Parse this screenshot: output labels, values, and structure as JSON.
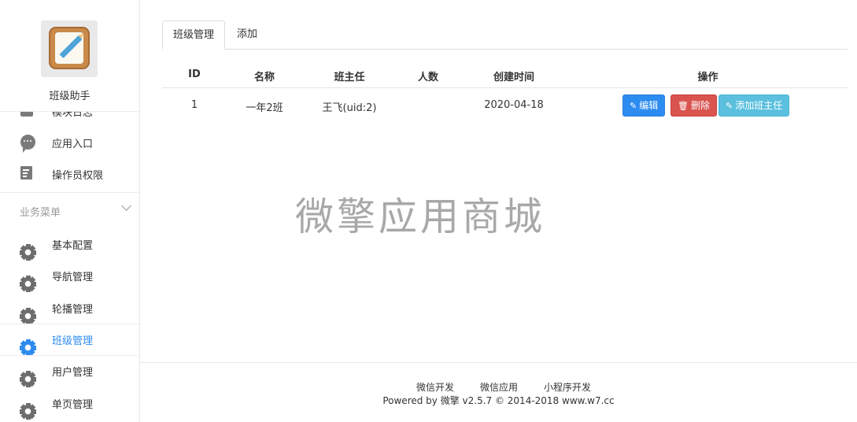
{
  "sidebar": {
    "app_name": "班级助手",
    "partial_item_label": "模块日志",
    "items_top": [
      {
        "label": "应用入口",
        "icon": "comment-icon"
      },
      {
        "label": "操作员权限",
        "icon": "edit-document-icon"
      }
    ],
    "section_title": "业务菜单",
    "business_items": [
      {
        "label": "基本配置",
        "icon": "gear-icon"
      },
      {
        "label": "导航管理",
        "icon": "gear-icon"
      },
      {
        "label": "轮播管理",
        "icon": "gear-icon"
      },
      {
        "label": "班级管理",
        "icon": "gear-icon",
        "active": true
      },
      {
        "label": "用户管理",
        "icon": "gear-icon"
      },
      {
        "label": "单页管理",
        "icon": "gear-icon"
      }
    ]
  },
  "tabs": [
    {
      "label": "班级管理",
      "active": true
    },
    {
      "label": "添加",
      "active": false
    }
  ],
  "table": {
    "headers": [
      "ID",
      "名称",
      "班主任",
      "人数",
      "创建时间",
      "操作"
    ],
    "rows": [
      {
        "id": "1",
        "name": "一年2班",
        "teacher": "王飞(uid:2)",
        "count": "",
        "created": "2020-04-18"
      }
    ],
    "actions": {
      "edit": "编辑",
      "delete": "删除",
      "add_teacher": "添加班主任"
    }
  },
  "watermark": "微擎应用商城",
  "footer": {
    "links": [
      "微信开发",
      "微信应用",
      "小程序开发"
    ],
    "powered": "Powered by 微擎 v2.5.7 © 2014-2018 www.w7.cc"
  },
  "colors": {
    "accent": "#2d8cf0",
    "danger": "#d9534f",
    "info": "#5bc0de"
  }
}
